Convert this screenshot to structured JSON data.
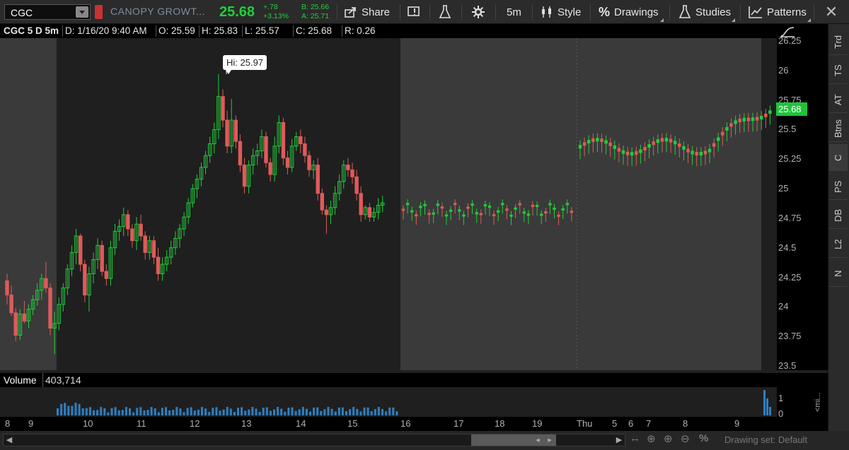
{
  "header": {
    "symbol": "CGC",
    "company_name": "CANOPY GROWT...",
    "last_price": "25.68",
    "net_change": "+.78",
    "pct_change": "+3.13%",
    "bid": "B: 25.66",
    "ask": "A: 25.71",
    "share_label": "Share",
    "timeframe_label": "5m",
    "style_label": "Style",
    "drawings_label": "Drawings",
    "studies_label": "Studies",
    "patterns_label": "Patterns",
    "up_color": "#1fcf3a",
    "down_color": "#e05a5a"
  },
  "infobar": {
    "title": "CGC 5 D 5m",
    "date": "D: 1/16/20 9:40 AM",
    "open": "O: 25.59",
    "high": "H: 25.83",
    "low": "L: 25.57",
    "close": "C: 25.68",
    "range": "R: 0.26"
  },
  "annotations": {
    "hi_label": "Hi: 25.97",
    "last_tag": "25.68"
  },
  "volume": {
    "label": "Volume",
    "value": "403,714",
    "axis_labels": [
      "1",
      "0"
    ],
    "side_label": "<mi..."
  },
  "sidebar": {
    "tabs": [
      "Trd",
      "TS",
      "AT",
      "Btns",
      "C",
      "PS",
      "DB",
      "L2",
      "N"
    ],
    "active": "C"
  },
  "footer": {
    "drawing_set": "Drawing set: Default"
  },
  "chart_data": {
    "type": "candlestick",
    "ylim": [
      23.5,
      26.25
    ],
    "y_ticks": [
      23.5,
      23.75,
      24,
      24.25,
      24.5,
      24.75,
      25,
      25.25,
      25.5,
      25.75,
      26,
      26.25
    ],
    "x_ticks": [
      "8",
      "9",
      "10",
      "11",
      "12",
      "13",
      "14",
      "15",
      "16",
      "17",
      "18",
      "19",
      "Thu",
      "5",
      "6",
      "7",
      "8",
      "9"
    ],
    "high_marker": 25.97,
    "last": 25.68,
    "candles": [
      [
        24.22,
        24.28,
        24.02,
        24.1
      ],
      [
        24.1,
        24.18,
        23.92,
        23.95
      ],
      [
        23.95,
        23.99,
        23.71,
        23.76
      ],
      [
        23.76,
        23.98,
        23.72,
        23.94
      ],
      [
        23.94,
        24.05,
        23.86,
        23.88
      ],
      [
        23.88,
        24.02,
        23.82,
        23.98
      ],
      [
        23.98,
        24.1,
        23.93,
        24.06
      ],
      [
        24.06,
        24.2,
        24.01,
        24.14
      ],
      [
        24.14,
        24.28,
        24.06,
        24.24
      ],
      [
        24.24,
        24.38,
        24.12,
        24.16
      ],
      [
        24.16,
        24.2,
        23.76,
        23.82
      ],
      [
        23.82,
        23.96,
        23.6,
        23.86
      ],
      [
        23.86,
        24.08,
        23.8,
        24.02
      ],
      [
        24.02,
        24.2,
        23.96,
        24.16
      ],
      [
        24.16,
        24.36,
        24.1,
        24.32
      ],
      [
        24.32,
        24.52,
        24.26,
        24.46
      ],
      [
        24.46,
        24.66,
        24.36,
        24.6
      ],
      [
        24.6,
        24.62,
        24.3,
        24.36
      ],
      [
        24.36,
        24.4,
        24.04,
        24.1
      ],
      [
        24.1,
        24.34,
        23.96,
        24.28
      ],
      [
        24.28,
        24.46,
        24.2,
        24.4
      ],
      [
        24.4,
        24.58,
        24.32,
        24.52
      ],
      [
        24.52,
        24.56,
        24.26,
        24.3
      ],
      [
        24.3,
        24.36,
        24.18,
        24.24
      ],
      [
        24.24,
        24.56,
        24.18,
        24.5
      ],
      [
        24.5,
        24.7,
        24.44,
        24.64
      ],
      [
        24.64,
        24.74,
        24.56,
        24.68
      ],
      [
        24.68,
        24.84,
        24.6,
        24.78
      ],
      [
        24.78,
        24.82,
        24.6,
        24.66
      ],
      [
        24.66,
        24.7,
        24.5,
        24.56
      ],
      [
        24.56,
        24.76,
        24.48,
        24.7
      ],
      [
        24.7,
        24.78,
        24.56,
        24.6
      ],
      [
        24.6,
        24.64,
        24.4,
        24.46
      ],
      [
        24.46,
        24.6,
        24.4,
        24.56
      ],
      [
        24.56,
        24.6,
        24.36,
        24.42
      ],
      [
        24.42,
        24.5,
        24.22,
        24.28
      ],
      [
        24.28,
        24.42,
        24.22,
        24.36
      ],
      [
        24.36,
        24.48,
        24.3,
        24.42
      ],
      [
        24.42,
        24.56,
        24.36,
        24.5
      ],
      [
        24.5,
        24.64,
        24.44,
        24.58
      ],
      [
        24.58,
        24.7,
        24.5,
        24.66
      ],
      [
        24.66,
        24.8,
        24.6,
        24.76
      ],
      [
        24.76,
        24.92,
        24.7,
        24.88
      ],
      [
        24.88,
        25.04,
        24.84,
        25.0
      ],
      [
        25.0,
        25.12,
        24.92,
        25.08
      ],
      [
        25.08,
        25.22,
        25.02,
        25.18
      ],
      [
        25.18,
        25.32,
        25.12,
        25.28
      ],
      [
        25.28,
        25.44,
        25.22,
        25.38
      ],
      [
        25.38,
        25.56,
        25.3,
        25.5
      ],
      [
        25.5,
        25.97,
        25.42,
        25.78
      ],
      [
        25.78,
        25.84,
        25.52,
        25.58
      ],
      [
        25.58,
        25.66,
        25.3,
        25.36
      ],
      [
        25.36,
        25.76,
        25.3,
        25.58
      ],
      [
        25.58,
        25.62,
        25.34,
        25.4
      ],
      [
        25.4,
        25.46,
        25.14,
        25.2
      ],
      [
        25.2,
        25.26,
        24.96,
        25.02
      ],
      [
        25.02,
        25.24,
        24.96,
        25.2
      ],
      [
        25.2,
        25.34,
        25.12,
        25.28
      ],
      [
        25.28,
        25.38,
        25.2,
        25.32
      ],
      [
        25.32,
        25.5,
        25.26,
        25.44
      ],
      [
        25.44,
        25.48,
        25.18,
        25.22
      ],
      [
        25.22,
        25.26,
        25.06,
        25.12
      ],
      [
        25.12,
        25.44,
        25.06,
        25.36
      ],
      [
        25.36,
        25.62,
        25.3,
        25.56
      ],
      [
        25.56,
        25.6,
        25.2,
        25.26
      ],
      [
        25.26,
        25.32,
        25.12,
        25.18
      ],
      [
        25.18,
        25.42,
        25.14,
        25.36
      ],
      [
        25.36,
        25.48,
        25.32,
        25.44
      ],
      [
        25.44,
        25.5,
        25.3,
        25.38
      ],
      [
        25.38,
        25.44,
        25.22,
        25.28
      ],
      [
        25.28,
        25.32,
        25.1,
        25.16
      ],
      [
        25.16,
        25.24,
        25.08,
        25.2
      ],
      [
        25.2,
        25.26,
        24.9,
        24.96
      ],
      [
        24.96,
        25.0,
        24.78,
        24.82
      ],
      [
        24.82,
        24.86,
        24.62,
        24.78
      ],
      [
        24.78,
        24.9,
        24.7,
        24.84
      ],
      [
        24.84,
        25.02,
        24.78,
        24.96
      ],
      [
        24.96,
        25.12,
        24.9,
        25.06
      ],
      [
        25.06,
        25.24,
        25.0,
        25.2
      ],
      [
        25.2,
        25.26,
        25.1,
        25.16
      ],
      [
        25.16,
        25.22,
        25.04,
        25.1
      ],
      [
        25.1,
        25.16,
        24.9,
        24.96
      ],
      [
        24.96,
        25.02,
        24.72,
        24.78
      ],
      [
        24.78,
        24.86,
        24.74,
        24.84
      ],
      [
        24.84,
        24.88,
        24.72,
        24.76
      ],
      [
        24.76,
        24.84,
        24.72,
        24.8
      ],
      [
        24.8,
        24.92,
        24.74,
        24.86
      ],
      [
        24.86,
        24.94,
        24.8,
        24.88
      ]
    ]
  }
}
